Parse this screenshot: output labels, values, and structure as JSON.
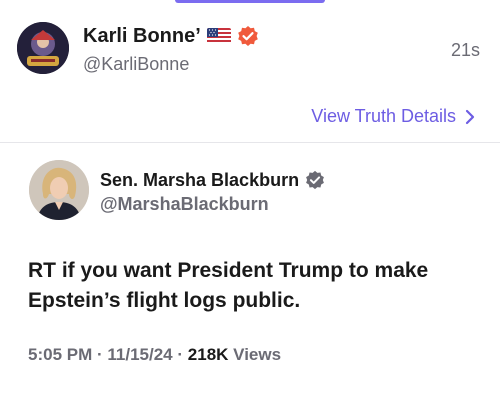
{
  "outer_post": {
    "author_name": "Karli Bonne’",
    "handle": "@KarliBonne",
    "time_ago": "21s",
    "flag_icon": "us-flag-icon",
    "verified_icon": "verified-badge-icon",
    "verified_color": "#f05a3c"
  },
  "details_link": {
    "label": "View Truth Details",
    "color": "#6d5de3"
  },
  "quoted_post": {
    "author_name": "Sen. Marsha Blackburn",
    "handle": "@MarshaBlackburn",
    "verified_icon": "verified-badge-icon",
    "verified_color": "#6b6b74",
    "text_line1": "RT if you want President Trump to make",
    "text_line2": "Epstein’s flight logs public.",
    "time": "5:05 PM",
    "date": "11/15/24",
    "views_count": "218K",
    "views_label": "Views",
    "separator": "·"
  }
}
